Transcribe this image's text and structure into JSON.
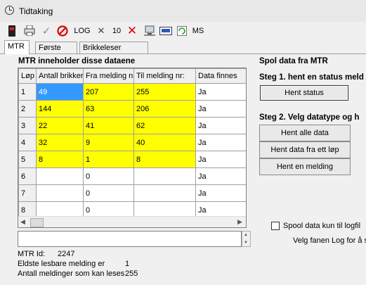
{
  "window": {
    "title": "Tidtaking"
  },
  "toolbar": {
    "log_label": "LOG",
    "count_label": "10",
    "ms_label": "MS"
  },
  "tabs": [
    "MTR",
    "Første side",
    "Brikkeleser klokke"
  ],
  "left": {
    "heading": "MTR inneholder disse dataene",
    "columns": [
      "Løp",
      "Antall brikker",
      "Fra melding nr",
      "Til melding nr:",
      "Data finnes"
    ],
    "rows": [
      [
        "1",
        "49",
        "207",
        "255",
        "Ja"
      ],
      [
        "2",
        "144",
        "63",
        "206",
        "Ja"
      ],
      [
        "3",
        "22",
        "41",
        "62",
        "Ja"
      ],
      [
        "4",
        "32",
        "9",
        "40",
        "Ja"
      ],
      [
        "5",
        "8",
        "1",
        "8",
        "Ja"
      ],
      [
        "6",
        "",
        "0",
        "",
        "Ja"
      ],
      [
        "7",
        "",
        "0",
        "",
        "Ja"
      ],
      [
        "8",
        "",
        "0",
        "",
        "Ja"
      ]
    ],
    "info": {
      "mtr_id_label": "MTR Id:",
      "mtr_id_value": "2247",
      "oldest_label": "Eldste lesbare melding er",
      "oldest_value": "1",
      "count_label": "Antall meldinger som kan leses",
      "count_value": "255"
    }
  },
  "right": {
    "heading": "Spol data fra MTR",
    "step1": "Steg 1. hent en status meld",
    "btn_status": "Hent status",
    "step2": "Steg 2. Velg datatype og h",
    "btn_all": "Hent alle data",
    "btn_run": "Hent data fra ett løp",
    "btn_one": "Hent en melding",
    "checkbox_label": "Spool data kun til logfil",
    "hint": "Velg fanen Log for å s"
  },
  "colors": {
    "highlight": "#ffff00",
    "selection": "#3399ff"
  }
}
